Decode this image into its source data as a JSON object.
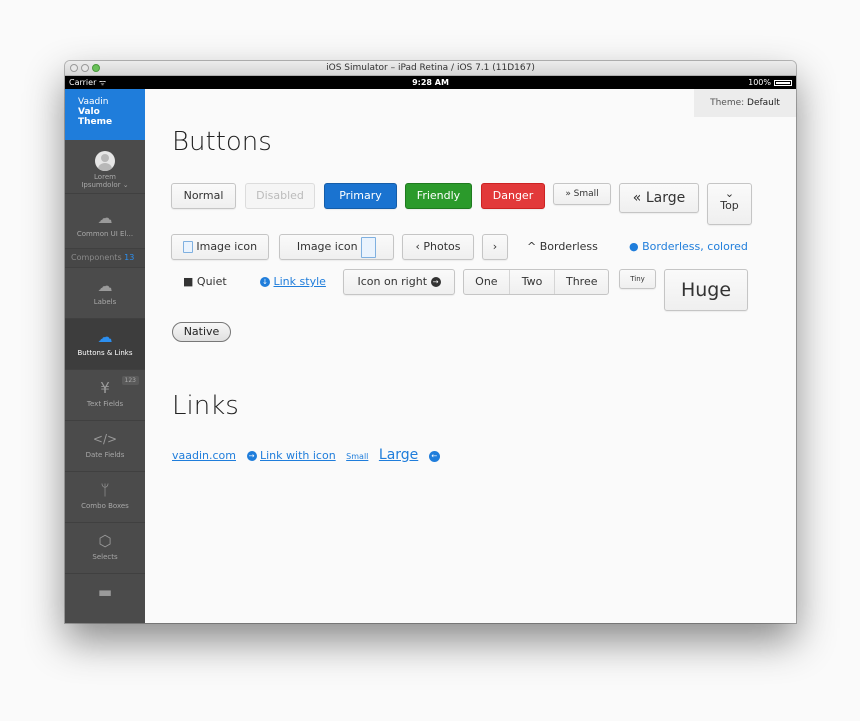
{
  "window": {
    "title": "iOS Simulator – iPad Retina / iOS 7.1 (11D167)"
  },
  "statusbar": {
    "carrier": "Carrier",
    "time": "9:28 AM",
    "battery": "100%"
  },
  "sidebar": {
    "brand_line1": "Vaadin",
    "brand_line2": "Valo",
    "brand_line3": "Theme",
    "user_line1": "Lorem",
    "user_line2": "Ipsumdolor ⌄",
    "items": [
      {
        "label": "Common UI El..."
      },
      {
        "label": "Labels"
      },
      {
        "label": "Buttons & Links"
      },
      {
        "label": "Text Fields",
        "badge": "123"
      },
      {
        "label": "Date Fields"
      },
      {
        "label": "Combo Boxes"
      },
      {
        "label": "Selects"
      }
    ],
    "section_label": "Components",
    "section_count": "13"
  },
  "theme": {
    "label": "Theme:",
    "value": "Default"
  },
  "buttons_section": {
    "title": "Buttons",
    "normal": "Normal",
    "disabled": "Disabled",
    "primary": "Primary",
    "friendly": "Friendly",
    "danger": "Danger",
    "small": "» Small",
    "large": "« Large",
    "top_icon": "⌄",
    "top": "Top",
    "image_icon_1": "Image icon",
    "image_icon_2": "Image icon",
    "photos": "‹ Photos",
    "next": "›",
    "borderless": "^ Borderless",
    "borderless_colored": "Borderless, colored",
    "quiet": "Quiet",
    "link_style": "Link style",
    "icon_on_right": "Icon on right",
    "seg_one": "One",
    "seg_two": "Two",
    "seg_three": "Three",
    "tiny": "Tiny",
    "huge": "Huge",
    "native": "Native"
  },
  "links_section": {
    "title": "Links",
    "vaadin": "vaadin.com",
    "link_with_icon": "Link with icon",
    "small": "Small",
    "large": "Large"
  },
  "colors": {
    "accent": "#1f7ddb",
    "friendly": "#2b9a2b",
    "danger": "#e2393a",
    "sidebar": "#4b4b4b"
  }
}
